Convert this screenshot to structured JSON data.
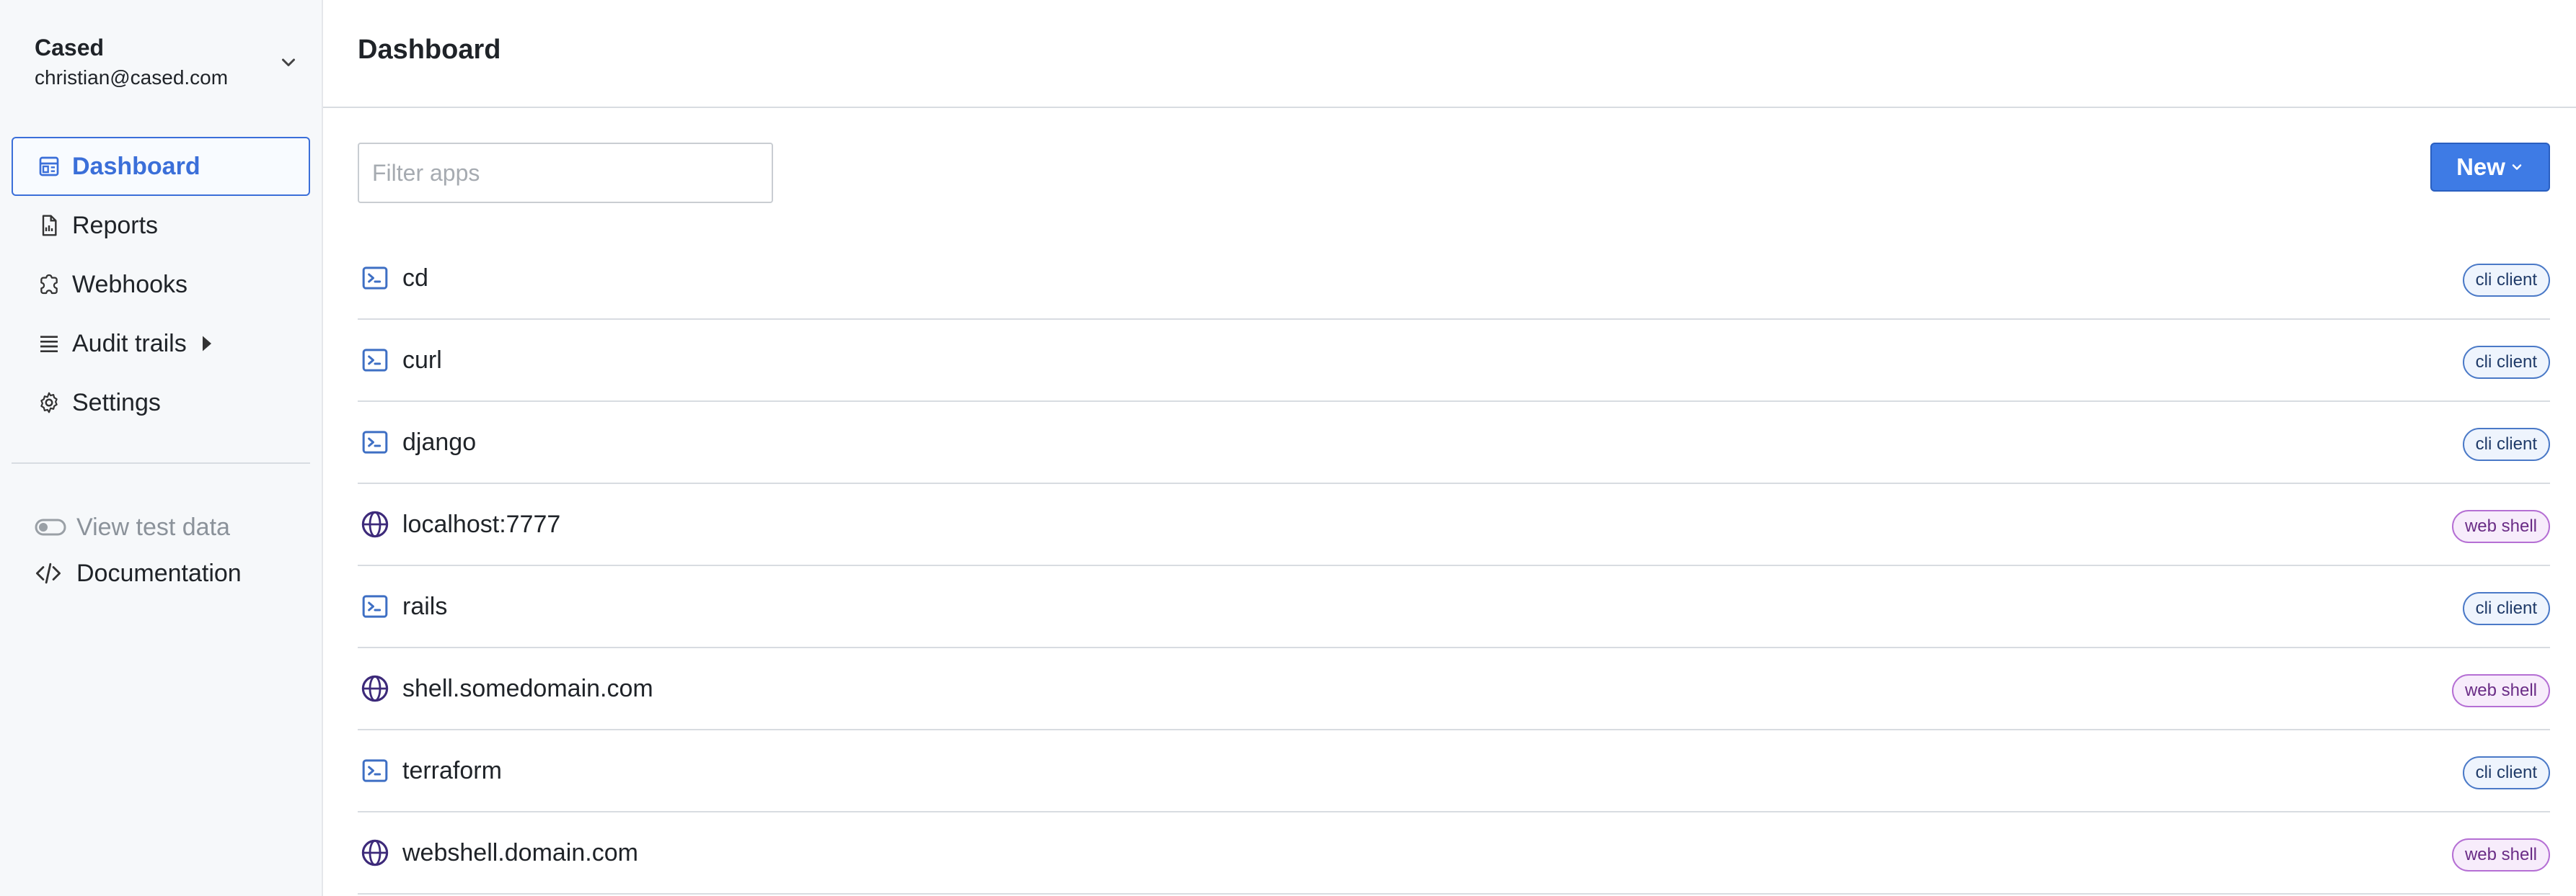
{
  "account": {
    "name": "Cased",
    "email": "christian@cased.com"
  },
  "nav": [
    {
      "label": "Dashboard",
      "icon": "layout-icon",
      "active": true
    },
    {
      "label": "Reports",
      "icon": "report-icon",
      "active": false
    },
    {
      "label": "Webhooks",
      "icon": "webhook-icon",
      "active": false
    },
    {
      "label": "Audit trails",
      "icon": "list-icon",
      "active": false
    },
    {
      "label": "Settings",
      "icon": "gear-icon",
      "active": false
    }
  ],
  "secondary": {
    "test_data": "View test data",
    "documentation": "Documentation"
  },
  "page": {
    "title": "Dashboard"
  },
  "filter": {
    "placeholder": "Filter apps",
    "value": ""
  },
  "new_button": {
    "label": "New"
  },
  "apps": [
    {
      "name": "cd",
      "type": "cli client",
      "icon": "terminal-icon"
    },
    {
      "name": "curl",
      "type": "cli client",
      "icon": "terminal-icon"
    },
    {
      "name": "django",
      "type": "cli client",
      "icon": "terminal-icon"
    },
    {
      "name": "localhost:7777",
      "type": "web shell",
      "icon": "globe-icon"
    },
    {
      "name": "rails",
      "type": "cli client",
      "icon": "terminal-icon"
    },
    {
      "name": "shell.somedomain.com",
      "type": "web shell",
      "icon": "globe-icon"
    },
    {
      "name": "terraform",
      "type": "cli client",
      "icon": "terminal-icon"
    },
    {
      "name": "webshell.domain.com",
      "type": "web shell",
      "icon": "globe-icon"
    }
  ],
  "colors": {
    "accent": "#3e7be5",
    "cli_badge_border": "#4a79c7",
    "web_badge_border": "#b56fd4",
    "globe_icon": "#3d2a7a"
  }
}
